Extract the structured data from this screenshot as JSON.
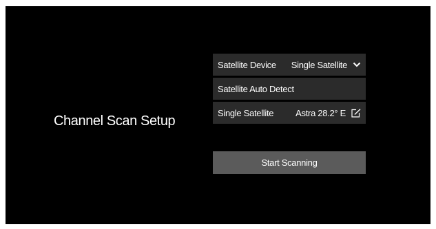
{
  "page": {
    "title": "Channel Scan Setup"
  },
  "settings": {
    "satellite_device": {
      "label": "Satellite Device",
      "value": "Single Satellite",
      "icon": "chevron-down-icon"
    },
    "auto_detect": {
      "label": "Satellite Auto Detect"
    },
    "single_satellite": {
      "label": "Single Satellite",
      "value": "Astra 28.2° E",
      "icon": "edit-icon"
    }
  },
  "actions": {
    "start_scanning": "Start Scanning"
  },
  "colors": {
    "background": "#000000",
    "row_background": "#2b2b2b",
    "button_background": "#5b5b5b",
    "text": "#ffffff"
  }
}
